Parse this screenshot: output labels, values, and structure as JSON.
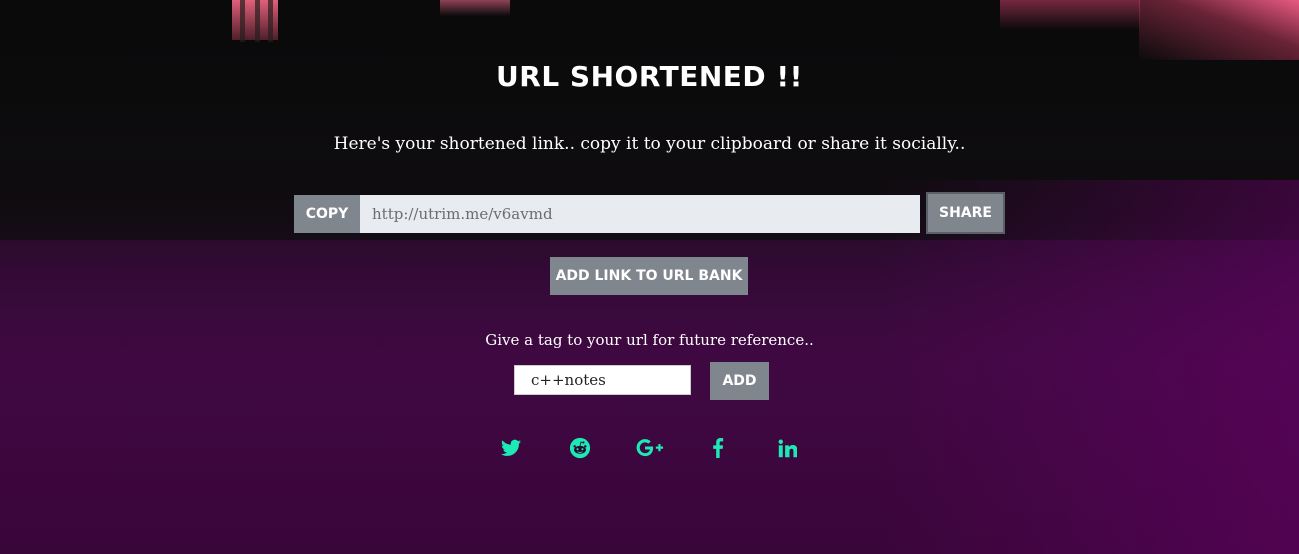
{
  "header": {
    "title": "URL SHORTENED !!",
    "subtitle": "Here's your shortened link.. copy it to your clipboard or share it socially.."
  },
  "url_row": {
    "copy_label": "COPY",
    "short_url": "http://utrim.me/v6avmd",
    "share_label": "SHARE"
  },
  "bank": {
    "add_label": "ADD LINK TO URL BANK"
  },
  "tag": {
    "prompt": "Give a tag to your url for future reference..",
    "value": "c++notes",
    "add_label": "ADD"
  },
  "social": {
    "accent_color": "#1de9b6",
    "icons": [
      "twitter-icon",
      "reddit-icon",
      "google-plus-icon",
      "facebook-icon",
      "linkedin-icon"
    ]
  },
  "colors": {
    "button_bg": "#7f868d",
    "input_bg": "#e8ebef"
  }
}
